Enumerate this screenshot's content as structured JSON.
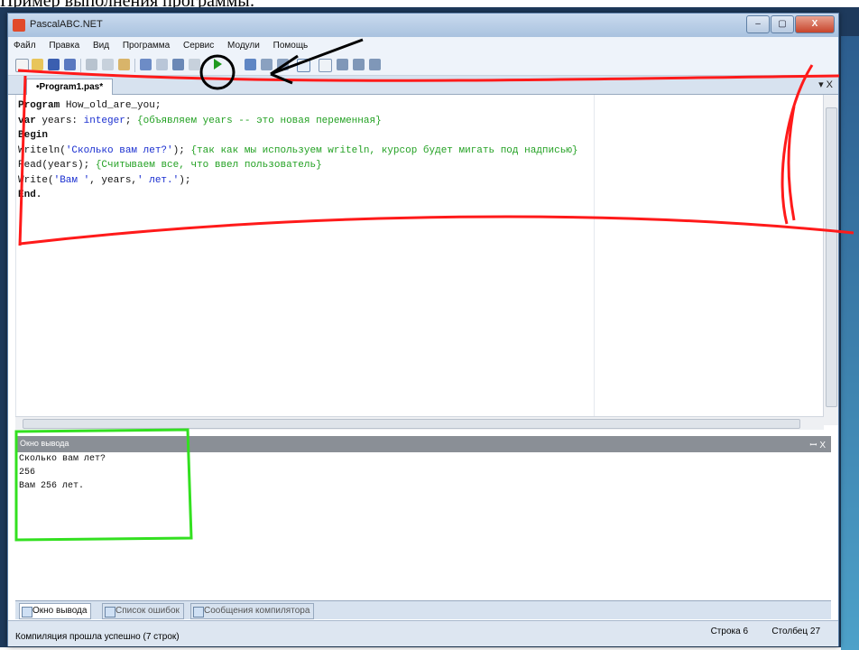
{
  "caption": "Пример выполнения программы:",
  "window": {
    "title": "PascalABC.NET",
    "controls": [
      "–",
      "▢",
      "X"
    ]
  },
  "menu": [
    "Файл",
    "Правка",
    "Вид",
    "Программа",
    "Сервис",
    "Модули",
    "Помощь"
  ],
  "editor": {
    "tab_label": "•Program1.pas*",
    "tab_controls": "▾ X",
    "code": {
      "line1_kw": "Program",
      "line1_rest": " How_old_are_you;",
      "line2_kw": "var",
      "line2_a": " years: ",
      "line2_type": "integer",
      "line2_b": "; ",
      "line2_comment": "{объявляем years -- это новая переменная}",
      "line3_kw": "Begin",
      "line4_a": "Writeln(",
      "line4_str": "'Сколько вам лет?'",
      "line4_b": "); ",
      "line4_comment": "{так как мы используем writeln, курсор будет мигать под надписью}",
      "line5_a": "Read(years); ",
      "line5_comment": "{Считываем все, что ввел пользователь}",
      "line6_a": "Write(",
      "line6_str1": "'Вам '",
      "line6_b": ", years,",
      "line6_str2": "' лет.'",
      "line6_c": ");",
      "line7_kw": "End."
    }
  },
  "output": {
    "title": "Окно вывода",
    "controls": "ꟷ X",
    "lines": [
      "Сколько вам лет?",
      "256",
      "Вам 256 лет."
    ]
  },
  "bottom_tabs": [
    "Окно вывода",
    "Список ошибок",
    "Сообщения компилятора"
  ],
  "status": {
    "message": "Компиляция прошла успешно (7 строк)",
    "row_label": "Строка 6",
    "col_label": "Столбец 27"
  },
  "annotations": {
    "run_circle_color": "#000000",
    "code_bracket_color": "#ff1a1a",
    "output_box_color": "#33e020"
  }
}
